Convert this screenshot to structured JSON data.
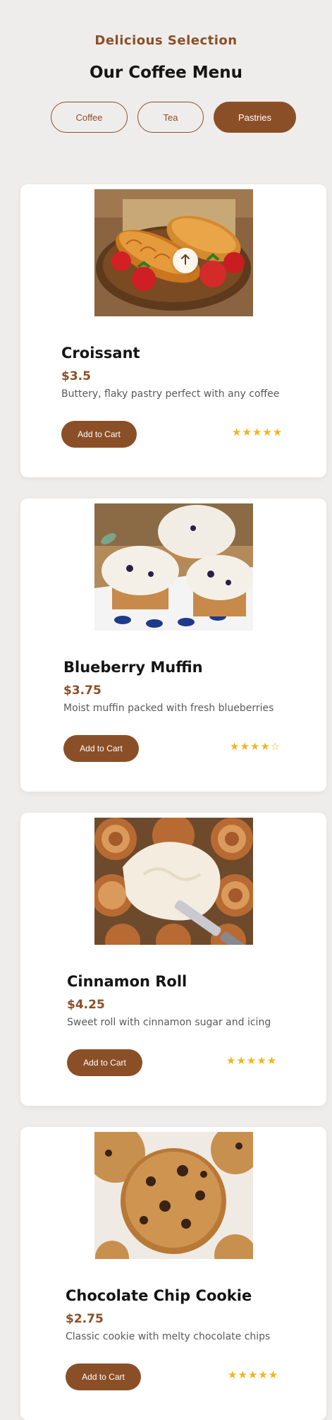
{
  "header": {
    "eyebrow": "Delicious Selection",
    "title": "Our Coffee Menu"
  },
  "tabs": [
    {
      "label": "Coffee",
      "active": false
    },
    {
      "label": "Tea",
      "active": false
    },
    {
      "label": "Pastries",
      "active": true
    }
  ],
  "products": [
    {
      "name": "Croissant",
      "price": "$3.5",
      "description": "Buttery, flaky pastry perfect with any coffee",
      "button_label": "Add to Cart",
      "rating_text": "★★★★★",
      "rating": 5
    },
    {
      "name": "Blueberry Muffin",
      "price": "$3.75",
      "description": "Moist muffin packed with fresh blueberries",
      "button_label": "Add to Cart",
      "rating_text": "★★★★☆",
      "rating": 4
    },
    {
      "name": "Cinnamon Roll",
      "price": "$4.25",
      "description": "Sweet roll with cinnamon sugar and icing",
      "button_label": "Add to Cart",
      "rating_text": "★★★★★",
      "rating": 5
    },
    {
      "name": "Chocolate Chip Cookie",
      "price": "$2.75",
      "description": "Classic cookie with melty chocolate chips",
      "button_label": "Add to Cart",
      "rating_text": "★★★★★",
      "rating": 5
    }
  ],
  "colors": {
    "accent": "#8b4f27",
    "star": "#f2b51c",
    "background": "#efedeb",
    "card": "#ffffff"
  },
  "icons": {
    "scroll_top": "arrow-up-icon"
  }
}
